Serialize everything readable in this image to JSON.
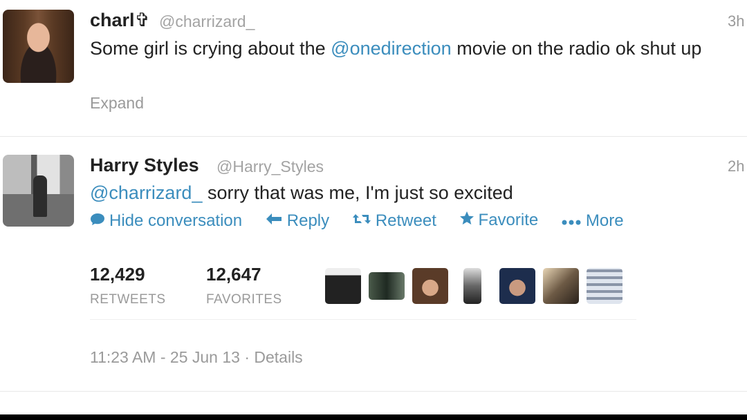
{
  "tweet1": {
    "name": "charl✞",
    "handle": "@charrizard_",
    "time": "3h",
    "text_before": "Some girl is crying about the ",
    "mention": "@onedirection",
    "text_after": " movie on the radio ok shut up",
    "expand": "Expand"
  },
  "tweet2": {
    "name": "Harry Styles",
    "handle": "@Harry_Styles",
    "time": "2h",
    "mention": "@charrizard_",
    "text": " sorry that was me, I'm just so excited",
    "actions": {
      "hide": "Hide conversation",
      "reply": "Reply",
      "retweet": "Retweet",
      "favorite": "Favorite",
      "more": "More"
    },
    "retweets_count": "12,429",
    "retweets_label": "RETWEETS",
    "favorites_count": "12,647",
    "favorites_label": "FAVORITES",
    "timestamp": "11:23 AM - 25 Jun 13 · Details"
  },
  "colors": {
    "link": "#3b8dbd",
    "muted": "#9a9a9a"
  }
}
